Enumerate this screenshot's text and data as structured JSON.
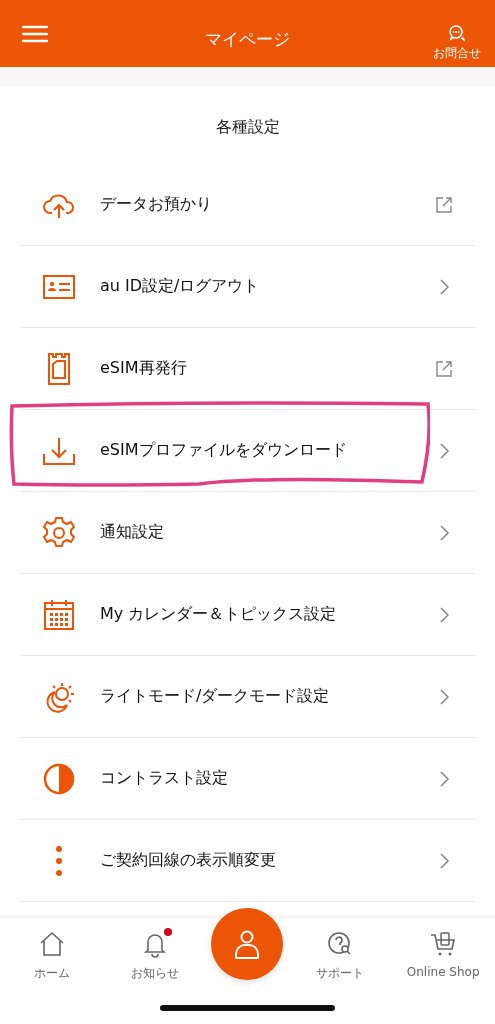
{
  "header": {
    "title": "マイページ",
    "contact_label": "お問合せ"
  },
  "section": {
    "title": "各種設定"
  },
  "items": [
    {
      "label": "データお預かり",
      "kind": "cloud",
      "external": true,
      "annotated": false
    },
    {
      "label": "au ID設定/ログアウト",
      "kind": "idcard",
      "external": false,
      "annotated": false
    },
    {
      "label": "eSIM再発行",
      "kind": "sim",
      "external": true,
      "annotated": false
    },
    {
      "label": "eSIMプロファイルをダウンロード",
      "kind": "download",
      "external": false,
      "annotated": true
    },
    {
      "label": "通知設定",
      "kind": "gear",
      "external": false,
      "annotated": false
    },
    {
      "label": "My カレンダー＆トピックス設定",
      "kind": "calendar",
      "external": false,
      "annotated": false
    },
    {
      "label": "ライトモード/ダークモード設定",
      "kind": "sunmoon",
      "external": false,
      "annotated": false
    },
    {
      "label": "コントラスト設定",
      "kind": "contrast",
      "external": false,
      "annotated": false
    },
    {
      "label": "ご契約回線の表示順変更",
      "kind": "dots",
      "external": false,
      "annotated": false
    }
  ],
  "nav": [
    {
      "kind": "home",
      "label": "ホーム",
      "badge": false,
      "selected": false
    },
    {
      "kind": "bell",
      "label": "お知らせ",
      "badge": true,
      "selected": false
    },
    {
      "kind": "person",
      "selected": true
    },
    {
      "kind": "support",
      "label": "サポート",
      "badge": false,
      "selected": false
    },
    {
      "kind": "shop",
      "label": "Online Shop",
      "badge": false,
      "selected": false
    }
  ]
}
